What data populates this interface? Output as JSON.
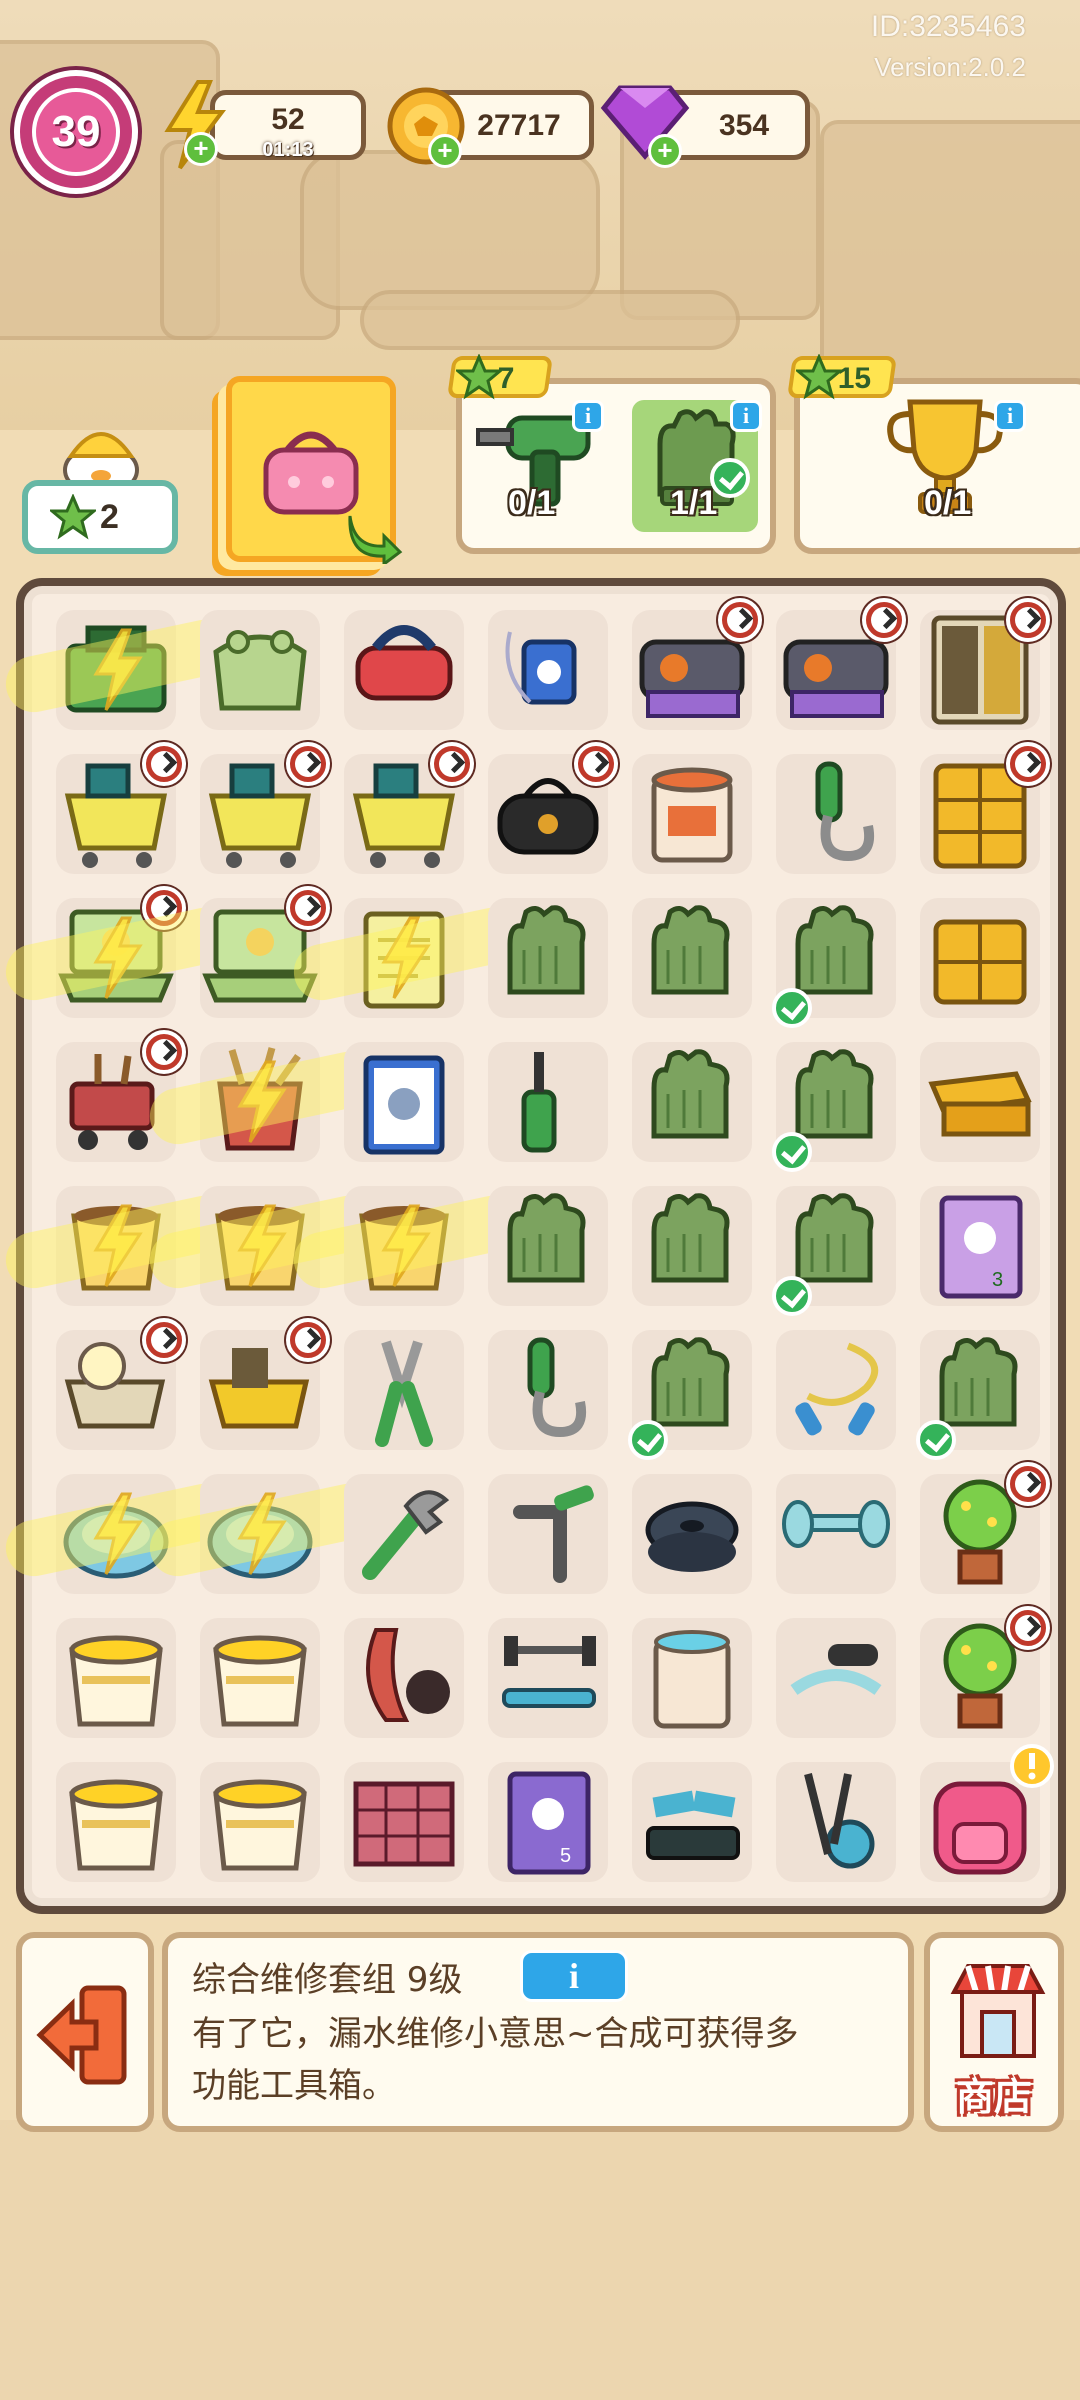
{
  "header": {
    "player_id": "ID:3235463",
    "version": "Version:2.0.2",
    "level": "39"
  },
  "resources": {
    "energy": {
      "value": "52",
      "timer": "01:13",
      "icon": "lightning-icon"
    },
    "coins": {
      "value": "27717",
      "icon": "coin-icon"
    },
    "gems": {
      "value": "354",
      "icon": "gem-icon"
    }
  },
  "quests": {
    "mascot_stars": "2",
    "card_item": "pink-handbag",
    "order_1": {
      "stars": "7",
      "items": [
        {
          "name": "drill",
          "progress": "0/1",
          "done": false
        },
        {
          "name": "garden-gloves",
          "progress": "1/1",
          "done": true
        }
      ]
    },
    "order_2": {
      "stars": "15",
      "items": [
        {
          "name": "trophy",
          "progress": "0/1",
          "done": false
        }
      ]
    }
  },
  "board": {
    "rows": [
      [
        "toolbox-green",
        "frog-pouch",
        "vr-goggles",
        "mp3-player",
        "gym-bags",
        "gym-bags",
        "locker-cabinet"
      ],
      [
        "shopping-cart-tools",
        "shopping-cart-tools",
        "shopping-cart-tools",
        "black-duffel-bag",
        "paint-bucket",
        "grip-trainer",
        "drawer-cabinet"
      ],
      [
        "laptop",
        "laptop",
        "notebook",
        "garden-gloves",
        "garden-gloves",
        "garden-gloves",
        "small-cabinet"
      ],
      [
        "tool-cart",
        "tool-bucket",
        "clipboard",
        "screwdriver",
        "garden-gloves",
        "garden-gloves",
        "drawer"
      ],
      [
        "seed-pot",
        "seed-pot",
        "seed-pot",
        "garden-gloves",
        "garden-gloves",
        "garden-gloves",
        "sticker-book"
      ],
      [
        "chick-cart",
        "book-cart",
        "pliers",
        "grip-trainer",
        "garden-gloves",
        "jump-rope",
        "garden-gloves"
      ],
      [
        "robot-vacuum",
        "robot-vacuum",
        "wrench",
        "hex-wrench",
        "weight-plates",
        "dumbbells",
        "potted-tree"
      ],
      [
        "yellow-bucket",
        "yellow-bucket",
        "resistance-band",
        "bench-press",
        "paint-can",
        "push-up-grip",
        "potted-tree"
      ],
      [
        "yellow-bucket",
        "yellow-bucket",
        "brick-pallet",
        "sticker-book-5",
        "stepper",
        "elliptical",
        "pink-backpack"
      ]
    ],
    "glow_cells": [
      "0-0",
      "2-0",
      "2-2",
      "3-1",
      "4-0",
      "4-1",
      "4-2",
      "6-0",
      "6-1"
    ],
    "arrow_badges": [
      "0-4",
      "0-5",
      "0-6",
      "1-0",
      "1-1",
      "1-2",
      "1-3",
      "1-6",
      "2-0",
      "2-1",
      "3-0",
      "5-0",
      "5-1",
      "6-6",
      "7-6"
    ],
    "check_badges": [
      "2-5",
      "3-5",
      "4-5",
      "5-4",
      "5-6"
    ],
    "alert_badge": "8-6"
  },
  "info_bar": {
    "title": "综合维修套组 9级",
    "info_label": "i",
    "description_line1": "有了它，漏水维修小意思~合成可获得多",
    "description_line2": "功能工具箱。",
    "shop_label": "商店"
  },
  "colors": {
    "board_border": "#5f4a3c",
    "panel_border": "#c7a77e",
    "info_blue": "#2ea6e8",
    "level_pink": "#e75a98"
  }
}
